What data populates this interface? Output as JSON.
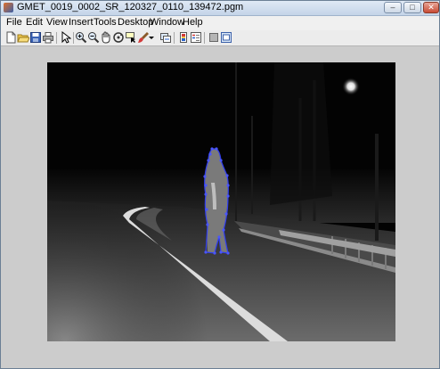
{
  "window": {
    "title": "GMET_0019_0002_SR_120327_0110_139472.pgm",
    "controls": {
      "minimize": "–",
      "maximize": "□",
      "close": "✕"
    }
  },
  "menu": [
    "File",
    "Edit",
    "View",
    "Insert",
    "Tools",
    "Desktop",
    "Window",
    "Help"
  ],
  "toolbar": [
    "new-figure-icon",
    "open-file-icon",
    "save-icon",
    "print-icon",
    "select-arrow-icon",
    "zoom-in-icon",
    "zoom-out-icon",
    "pan-icon",
    "rotate-3d-icon",
    "data-cursor-icon",
    "brush-icon",
    "brush-dropdown-icon",
    "link-plot-icon",
    "insert-colorbar-icon",
    "insert-legend-icon",
    "hide-plot-tools-icon",
    "show-plot-tools-icon"
  ],
  "image": {
    "scene": "night infrared road scene with pedestrian",
    "annotation_color": "#2f3cf0",
    "annotation_shape": "pedestrian outline contour"
  }
}
